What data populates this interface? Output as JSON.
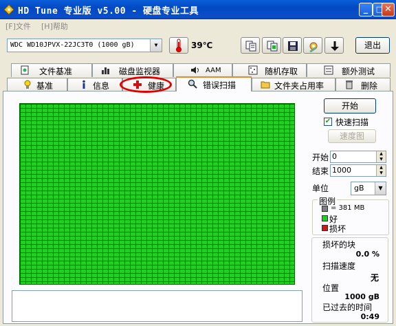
{
  "window": {
    "title": "HD Tune 专业版 v5.00 - 硬盘专业工具"
  },
  "menu": {
    "file": "[F]文件",
    "help": "[H]帮助"
  },
  "toolbar": {
    "drive": "WDC WD10JPVX-22JC3T0 (1000 gB)",
    "temperature": "39℃",
    "exit_label": "退出"
  },
  "tabs_top": [
    "文件基准",
    "磁盘监视器",
    "AAM",
    "随机存取",
    "额外测试"
  ],
  "tabs_bottom": [
    "基准",
    "信息",
    "健康",
    "错误扫描",
    "文件夹占用率",
    "删除"
  ],
  "scan": {
    "start_button": "开始",
    "quick_scan_label": "快速扫描",
    "quick_scan_checked": true,
    "speed_map_button": "速度图",
    "start_label": "开始",
    "start_value": "0",
    "end_label": "结束",
    "end_value": "1000",
    "unit_label": "单位",
    "unit_value": "gB"
  },
  "legend": {
    "title": "图例",
    "block_size": "= 381 MB",
    "good": "好",
    "damaged": "损坏",
    "colors": {
      "block": "#808080",
      "good": "#20d020",
      "damaged": "#d01818"
    }
  },
  "stats": {
    "damaged_blocks_label": "损坏的块",
    "damaged_blocks_value": "0.0 %",
    "scan_speed_label": "扫描速度",
    "scan_speed_value": "无",
    "position_label": "位置",
    "position_value": "1000 gB",
    "elapsed_label": "已过去的时间",
    "elapsed_value": "0:49"
  }
}
